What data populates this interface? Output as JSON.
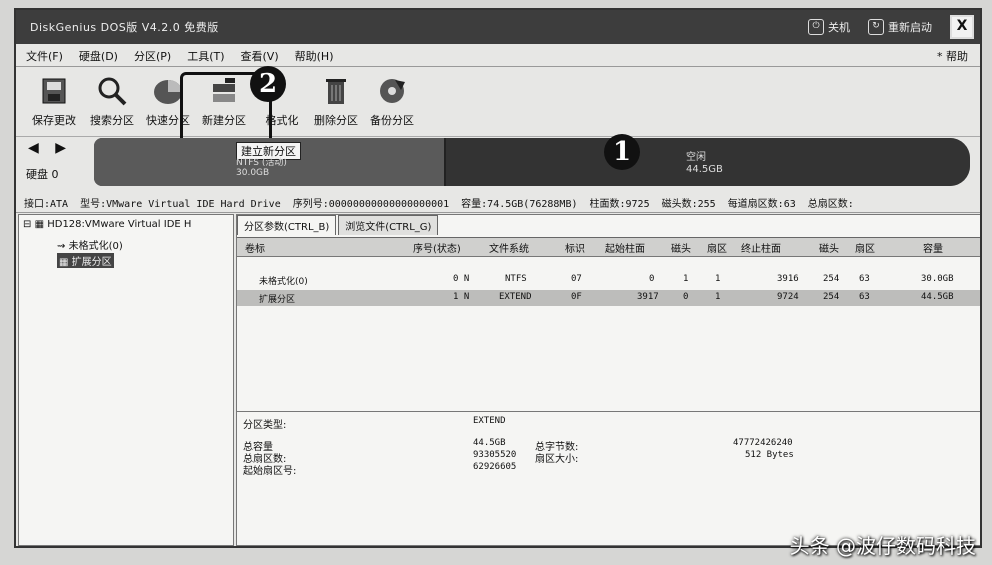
{
  "window": {
    "title": "DiskGenius DOS版 V4.2.0 免费版",
    "shutdown_label": "关机",
    "reboot_label": "重新启动",
    "close_glyph": "X"
  },
  "menu": {
    "items": [
      "文件(F)",
      "硬盘(D)",
      "分区(P)",
      "工具(T)",
      "查看(V)",
      "帮助(H)"
    ],
    "help_right": "* 帮助"
  },
  "toolbar": {
    "items": [
      {
        "label": "保存更改",
        "icon": "save-icon"
      },
      {
        "label": "搜索分区",
        "icon": "search-icon"
      },
      {
        "label": "快速分区",
        "icon": "quick-partition-icon"
      },
      {
        "label": "新建分区",
        "icon": "new-partition-icon"
      },
      {
        "label": "格式化",
        "icon": "format-icon"
      },
      {
        "label": "删除分区",
        "icon": "delete-icon"
      },
      {
        "label": "备份分区",
        "icon": "backup-icon"
      }
    ]
  },
  "annotations": {
    "badge_1": "1",
    "badge_2": "2"
  },
  "diskmap": {
    "nav": "◀ ▶",
    "disk_label": "硬盘 0",
    "popup_label": "建立新分区",
    "seg1_fs": "NTFS (活动)",
    "seg1_size": "30.0GB",
    "free_label": "空闲",
    "free_size": "44.5GB"
  },
  "diskinfo": {
    "interface": "接口:ATA",
    "model": "型号:VMware Virtual IDE Hard Drive",
    "serial": "序列号:00000000000000000001",
    "capacity": "容量:74.5GB(76288MB)",
    "cylinders": "柱面数:9725",
    "heads": "磁头数:255",
    "sectors_per_track": "每道扇区数:63",
    "total_sectors": "总扇区数:"
  },
  "tree": {
    "disk": "HD128:VMware Virtual IDE H",
    "items": [
      "未格式化(0)",
      "扩展分区"
    ]
  },
  "tabs": [
    "分区参数(CTRL_B)",
    "浏览文件(CTRL_G)"
  ],
  "table": {
    "headers": [
      "卷标",
      "序号(状态)",
      "文件系统",
      "标识",
      "起始柱面",
      "磁头",
      "扇区",
      "终止柱面",
      "磁头",
      "扇区",
      "容量"
    ],
    "rows": [
      [
        "未格式化(0)",
        "0 N",
        "NTFS",
        "07",
        "0",
        "1",
        "1",
        "3916",
        "254",
        "63",
        "30.0GB"
      ],
      [
        "扩展分区",
        "1 N",
        "EXTEND",
        "0F",
        "3917",
        "0",
        "1",
        "9724",
        "254",
        "63",
        "44.5GB"
      ]
    ]
  },
  "details": {
    "type_label": "分区类型:",
    "type_value": "EXTEND",
    "total_cap_label": "总容量",
    "total_cap_value": "44.5GB",
    "total_sec_label": "总扇区数:",
    "total_sec_value": "93305520",
    "start_sec_label": "起始扇区号:",
    "start_sec_value": "62926605",
    "total_bytes_label": "总字节数:",
    "total_bytes_value": "47772426240",
    "sector_size_label": "扇区大小:",
    "sector_size_value": "512 Bytes"
  },
  "watermark": "头条 @波仔数码科技"
}
